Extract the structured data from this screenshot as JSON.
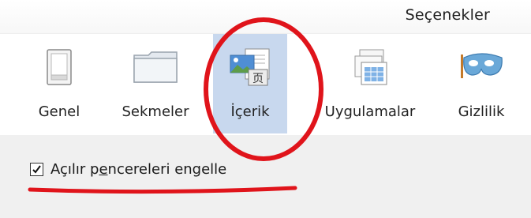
{
  "window": {
    "title": "Seçenekler"
  },
  "tabs": [
    {
      "id": "genel",
      "label": "Genel",
      "icon": "switch-icon"
    },
    {
      "id": "sekmeler",
      "label": "Sekmeler",
      "icon": "folder-icon"
    },
    {
      "id": "icerik",
      "label": "İçerik",
      "icon": "content-icon",
      "selected": true
    },
    {
      "id": "uygulamalar",
      "label": "Uygulamalar",
      "icon": "applications-icon"
    },
    {
      "id": "gizlilik",
      "label": "Gizlilik",
      "icon": "mask-icon"
    }
  ],
  "content": {
    "popup_block": {
      "label_before": "Açılır p",
      "label_accesskey": "e",
      "label_after": "ncereleri engelle",
      "checked": true
    }
  },
  "colors": {
    "selected_tab": "#c8d8ee",
    "annotation_red": "#e0141b"
  }
}
